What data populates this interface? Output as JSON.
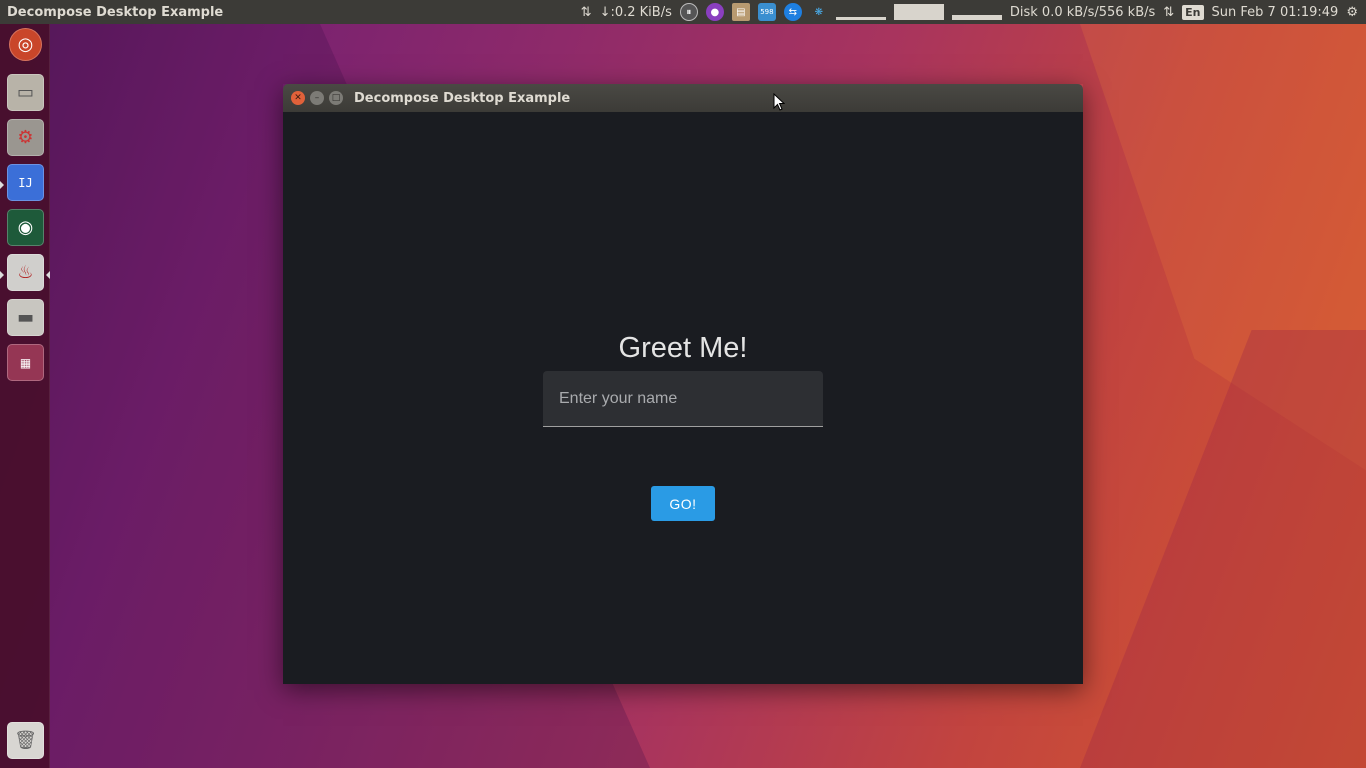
{
  "top_panel": {
    "app_title": "Decompose Desktop Example",
    "net_speed": "↓:0.2 KiB/s",
    "disk_io": "Disk 0.0 kB/s/556 kB/s",
    "keyboard_layout": "En",
    "clock": "Sun Feb  7 01:19:49",
    "badge_count": "598"
  },
  "launcher": {
    "items": [
      "ubuntu-logo-icon",
      "files-icon",
      "settings-icon",
      "intellij-icon",
      "globe-icon",
      "java-icon",
      "disk-icon",
      "workspace-icon"
    ],
    "trash": "trash-icon"
  },
  "window": {
    "title": "Decompose Desktop Example",
    "heading": "Greet Me!",
    "name_input": {
      "placeholder": "Enter your name",
      "value": ""
    },
    "go_button_label": "GO!",
    "colors": {
      "background": "#1a1c21",
      "button": "#2a9be5"
    }
  }
}
